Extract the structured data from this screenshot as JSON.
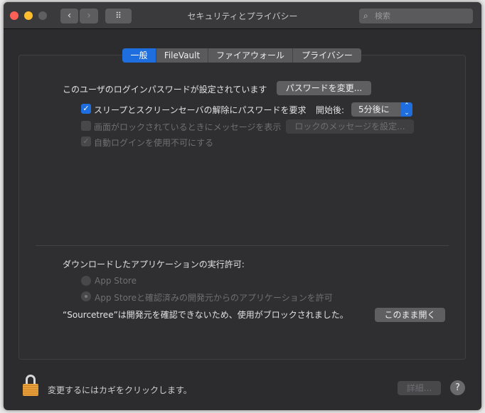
{
  "window": {
    "title": "セキュリティとプライバシー",
    "search_placeholder": "検索",
    "back": "‹",
    "forward": "›",
    "grid": "⠿"
  },
  "tabs": [
    {
      "label": "一般",
      "active": true
    },
    {
      "label": "FileVault"
    },
    {
      "label": "ファイアウォール"
    },
    {
      "label": "プライバシー"
    }
  ],
  "general": {
    "password_set_text": "このユーザのログインパスワードが設定されています",
    "change_password_button": "パスワードを変更...",
    "require_password_label": "スリープとスクリーンセーバの解除にパスワードを要求",
    "require_password_checked": true,
    "after_label": "開始後:",
    "after_value": "5分後に",
    "show_message_label": "画面がロックされているときにメッセージを表示",
    "show_message_checked": false,
    "set_lock_message_button": "ロックのメッセージを設定...",
    "disable_autologin_label": "自動ログインを使用不可にする",
    "disable_autologin_checked": true
  },
  "downloads": {
    "heading": "ダウンロードしたアプリケーションの実行許可:",
    "options": [
      {
        "label": "App Store",
        "selected": false
      },
      {
        "label": "App Storeと確認済みの開発元からのアプリケーションを許可",
        "selected": true
      }
    ],
    "blocked_text": "“Sourcetree”は開発元を確認できないため、使用がブロックされました。",
    "open_anyway_button": "このまま開く"
  },
  "footer": {
    "lock_text": "変更するにはカギをクリックします。",
    "advanced_button": "詳細...",
    "help": "?"
  },
  "colors": {
    "accent": "#1f6ee0",
    "lock": "#e9a23b"
  }
}
